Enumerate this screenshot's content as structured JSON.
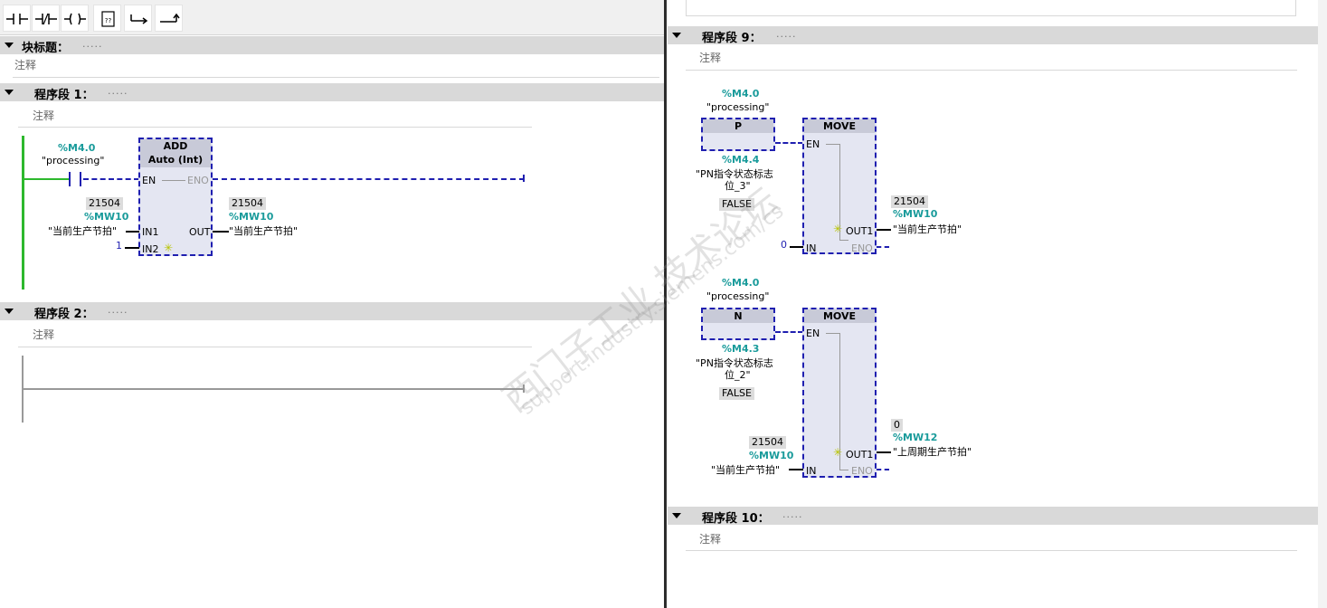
{
  "left": {
    "block_title_label": "块标题：",
    "block_title_dots": ".....",
    "block_comment": "注释",
    "network1": {
      "title": "程序段 1：",
      "dots": ".....",
      "comment": "注释",
      "contact_addr": "%M4.0",
      "contact_name": "\"processing\"",
      "box_name": "ADD",
      "box_type": "Auto (Int)",
      "pin_en": "EN",
      "pin_eno": "ENO",
      "pin_in1": "IN1",
      "pin_in2": "IN2",
      "pin_out": "OUT",
      "in1_value": "21504",
      "in1_addr": "%MW10",
      "in1_name": "\"当前生产节拍\"",
      "in2_value": "1",
      "out_value": "21504",
      "out_addr": "%MW10",
      "out_name": "\"当前生产节拍\""
    },
    "network2": {
      "title": "程序段 2：",
      "dots": ".....",
      "comment": "注释"
    }
  },
  "right": {
    "network9": {
      "title": "程序段 9：",
      "dots": ".....",
      "comment": "注释",
      "rung1": {
        "contact_addr": "%M4.0",
        "contact_name": "\"processing\"",
        "edge_box": "P",
        "flag_addr": "%M4.4",
        "flag_name_line1": "\"PN指令状态标志",
        "flag_name_line2": "位_3\"",
        "flag_value": "FALSE",
        "move_name": "MOVE",
        "pin_en": "EN",
        "pin_in": "IN",
        "pin_out1": "OUT1",
        "pin_eno": "ENO",
        "in_value": "0",
        "out_value": "21504",
        "out_addr": "%MW10",
        "out_name": "\"当前生产节拍\""
      },
      "rung2": {
        "contact_addr": "%M4.0",
        "contact_name": "\"processing\"",
        "edge_box": "N",
        "flag_addr": "%M4.3",
        "flag_name_line1": "\"PN指令状态标志",
        "flag_name_line2": "位_2\"",
        "flag_value": "FALSE",
        "move_name": "MOVE",
        "pin_en": "EN",
        "pin_in": "IN",
        "pin_out1": "OUT1",
        "pin_eno": "ENO",
        "in_value": "21504",
        "in_addr": "%MW10",
        "in_name": "\"当前生产节拍\"",
        "out_value": "0",
        "out_addr": "%MW12",
        "out_name": "\"上周期生产节拍\""
      }
    },
    "network10": {
      "title": "程序段 10：",
      "dots": ".....",
      "comment": "注释"
    }
  },
  "watermark": {
    "text_cn": "西门子工业   技术论坛",
    "text_url": "support.industry.siemens.com/cs"
  },
  "colors": {
    "accent_blue": "#1f1fb0",
    "power_rail_green": "#2db82d",
    "address_teal": "#1a9b9b",
    "header_gray": "#d9d9d9"
  },
  "icons": [
    "no-contact-icon",
    "nc-contact-icon",
    "coil-icon",
    "empty-box-icon",
    "open-branch-icon",
    "close-branch-icon"
  ]
}
